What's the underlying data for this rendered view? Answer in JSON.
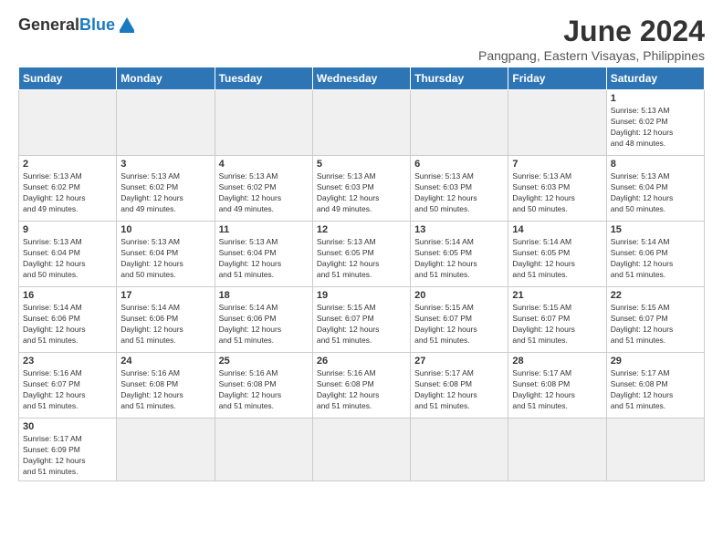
{
  "header": {
    "logo_general": "General",
    "logo_blue": "Blue",
    "month_title": "June 2024",
    "subtitle": "Pangpang, Eastern Visayas, Philippines"
  },
  "days_of_week": [
    "Sunday",
    "Monday",
    "Tuesday",
    "Wednesday",
    "Thursday",
    "Friday",
    "Saturday"
  ],
  "weeks": [
    [
      {
        "day": "",
        "info": "",
        "empty": true
      },
      {
        "day": "",
        "info": "",
        "empty": true
      },
      {
        "day": "",
        "info": "",
        "empty": true
      },
      {
        "day": "",
        "info": "",
        "empty": true
      },
      {
        "day": "",
        "info": "",
        "empty": true
      },
      {
        "day": "",
        "info": "",
        "empty": true
      },
      {
        "day": "1",
        "info": "Sunrise: 5:13 AM\nSunset: 6:02 PM\nDaylight: 12 hours\nand 48 minutes."
      }
    ],
    [
      {
        "day": "2",
        "info": "Sunrise: 5:13 AM\nSunset: 6:02 PM\nDaylight: 12 hours\nand 49 minutes."
      },
      {
        "day": "3",
        "info": "Sunrise: 5:13 AM\nSunset: 6:02 PM\nDaylight: 12 hours\nand 49 minutes."
      },
      {
        "day": "4",
        "info": "Sunrise: 5:13 AM\nSunset: 6:02 PM\nDaylight: 12 hours\nand 49 minutes."
      },
      {
        "day": "5",
        "info": "Sunrise: 5:13 AM\nSunset: 6:03 PM\nDaylight: 12 hours\nand 49 minutes."
      },
      {
        "day": "6",
        "info": "Sunrise: 5:13 AM\nSunset: 6:03 PM\nDaylight: 12 hours\nand 50 minutes."
      },
      {
        "day": "7",
        "info": "Sunrise: 5:13 AM\nSunset: 6:03 PM\nDaylight: 12 hours\nand 50 minutes."
      },
      {
        "day": "8",
        "info": "Sunrise: 5:13 AM\nSunset: 6:04 PM\nDaylight: 12 hours\nand 50 minutes."
      }
    ],
    [
      {
        "day": "9",
        "info": "Sunrise: 5:13 AM\nSunset: 6:04 PM\nDaylight: 12 hours\nand 50 minutes."
      },
      {
        "day": "10",
        "info": "Sunrise: 5:13 AM\nSunset: 6:04 PM\nDaylight: 12 hours\nand 50 minutes."
      },
      {
        "day": "11",
        "info": "Sunrise: 5:13 AM\nSunset: 6:04 PM\nDaylight: 12 hours\nand 51 minutes."
      },
      {
        "day": "12",
        "info": "Sunrise: 5:13 AM\nSunset: 6:05 PM\nDaylight: 12 hours\nand 51 minutes."
      },
      {
        "day": "13",
        "info": "Sunrise: 5:14 AM\nSunset: 6:05 PM\nDaylight: 12 hours\nand 51 minutes."
      },
      {
        "day": "14",
        "info": "Sunrise: 5:14 AM\nSunset: 6:05 PM\nDaylight: 12 hours\nand 51 minutes."
      },
      {
        "day": "15",
        "info": "Sunrise: 5:14 AM\nSunset: 6:06 PM\nDaylight: 12 hours\nand 51 minutes."
      }
    ],
    [
      {
        "day": "16",
        "info": "Sunrise: 5:14 AM\nSunset: 6:06 PM\nDaylight: 12 hours\nand 51 minutes."
      },
      {
        "day": "17",
        "info": "Sunrise: 5:14 AM\nSunset: 6:06 PM\nDaylight: 12 hours\nand 51 minutes."
      },
      {
        "day": "18",
        "info": "Sunrise: 5:14 AM\nSunset: 6:06 PM\nDaylight: 12 hours\nand 51 minutes."
      },
      {
        "day": "19",
        "info": "Sunrise: 5:15 AM\nSunset: 6:07 PM\nDaylight: 12 hours\nand 51 minutes."
      },
      {
        "day": "20",
        "info": "Sunrise: 5:15 AM\nSunset: 6:07 PM\nDaylight: 12 hours\nand 51 minutes."
      },
      {
        "day": "21",
        "info": "Sunrise: 5:15 AM\nSunset: 6:07 PM\nDaylight: 12 hours\nand 51 minutes."
      },
      {
        "day": "22",
        "info": "Sunrise: 5:15 AM\nSunset: 6:07 PM\nDaylight: 12 hours\nand 51 minutes."
      }
    ],
    [
      {
        "day": "23",
        "info": "Sunrise: 5:16 AM\nSunset: 6:07 PM\nDaylight: 12 hours\nand 51 minutes."
      },
      {
        "day": "24",
        "info": "Sunrise: 5:16 AM\nSunset: 6:08 PM\nDaylight: 12 hours\nand 51 minutes."
      },
      {
        "day": "25",
        "info": "Sunrise: 5:16 AM\nSunset: 6:08 PM\nDaylight: 12 hours\nand 51 minutes."
      },
      {
        "day": "26",
        "info": "Sunrise: 5:16 AM\nSunset: 6:08 PM\nDaylight: 12 hours\nand 51 minutes."
      },
      {
        "day": "27",
        "info": "Sunrise: 5:17 AM\nSunset: 6:08 PM\nDaylight: 12 hours\nand 51 minutes."
      },
      {
        "day": "28",
        "info": "Sunrise: 5:17 AM\nSunset: 6:08 PM\nDaylight: 12 hours\nand 51 minutes."
      },
      {
        "day": "29",
        "info": "Sunrise: 5:17 AM\nSunset: 6:08 PM\nDaylight: 12 hours\nand 51 minutes."
      }
    ],
    [
      {
        "day": "30",
        "info": "Sunrise: 5:17 AM\nSunset: 6:09 PM\nDaylight: 12 hours\nand 51 minutes.",
        "last": true
      },
      {
        "day": "",
        "info": "",
        "empty": true,
        "last": true
      },
      {
        "day": "",
        "info": "",
        "empty": true,
        "last": true
      },
      {
        "day": "",
        "info": "",
        "empty": true,
        "last": true
      },
      {
        "day": "",
        "info": "",
        "empty": true,
        "last": true
      },
      {
        "day": "",
        "info": "",
        "empty": true,
        "last": true
      },
      {
        "day": "",
        "info": "",
        "empty": true,
        "last": true
      }
    ]
  ]
}
